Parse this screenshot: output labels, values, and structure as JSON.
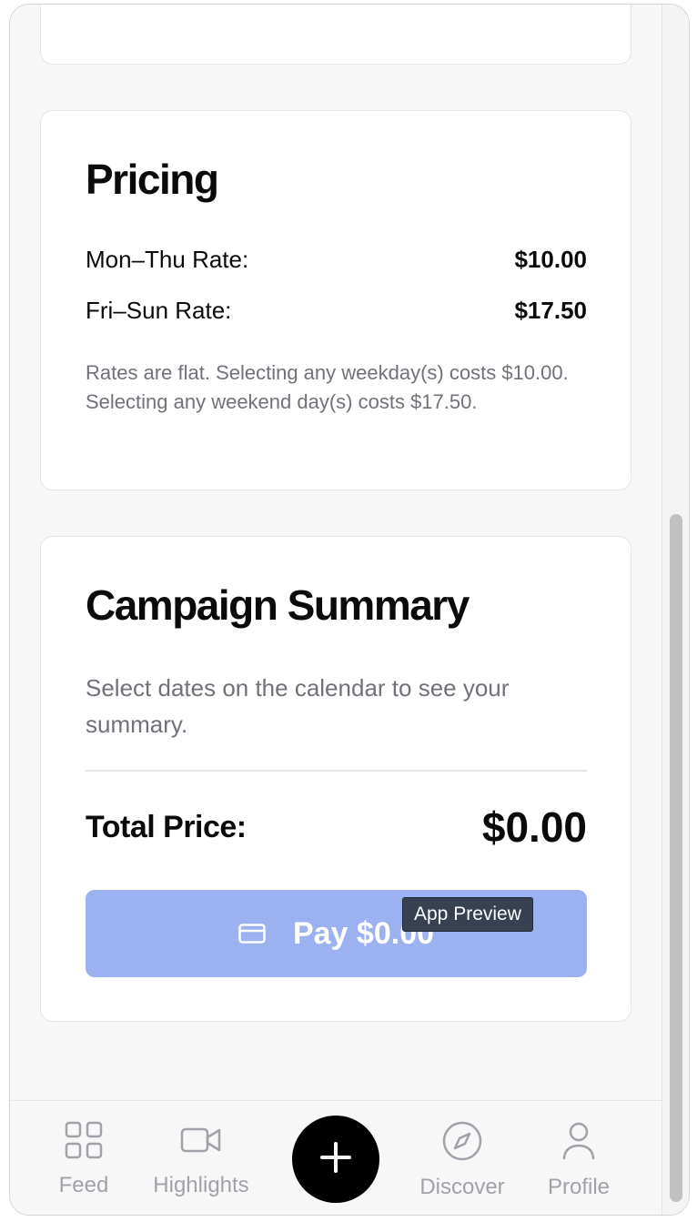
{
  "pricing": {
    "title": "Pricing",
    "weekday_label": "Mon–Thu Rate:",
    "weekday_value": "$10.00",
    "weekend_label": "Fri–Sun Rate:",
    "weekend_value": "$17.50",
    "note": "Rates are flat. Selecting any weekday(s) costs $10.00. Selecting any weekend day(s) costs $17.50."
  },
  "summary": {
    "title": "Campaign Summary",
    "empty_text": "Select dates on the calendar to see your summary.",
    "total_label": "Total Price:",
    "total_value": "$0.00",
    "pay_label": "Pay $0.00",
    "pay_icon": "credit-card-icon"
  },
  "tooltip": {
    "text": "App Preview"
  },
  "nav": {
    "items": [
      {
        "label": "Feed",
        "icon": "grid-icon"
      },
      {
        "label": "Highlights",
        "icon": "video-camera-icon"
      },
      {
        "label": "",
        "icon": "plus-icon"
      },
      {
        "label": "Discover",
        "icon": "compass-icon"
      },
      {
        "label": "Profile",
        "icon": "user-icon"
      }
    ]
  },
  "colors": {
    "pay_button": "#9bb1f0",
    "fab": "#000000",
    "muted_text": "#71717a",
    "nav_inactive": "#a1a1aa"
  }
}
